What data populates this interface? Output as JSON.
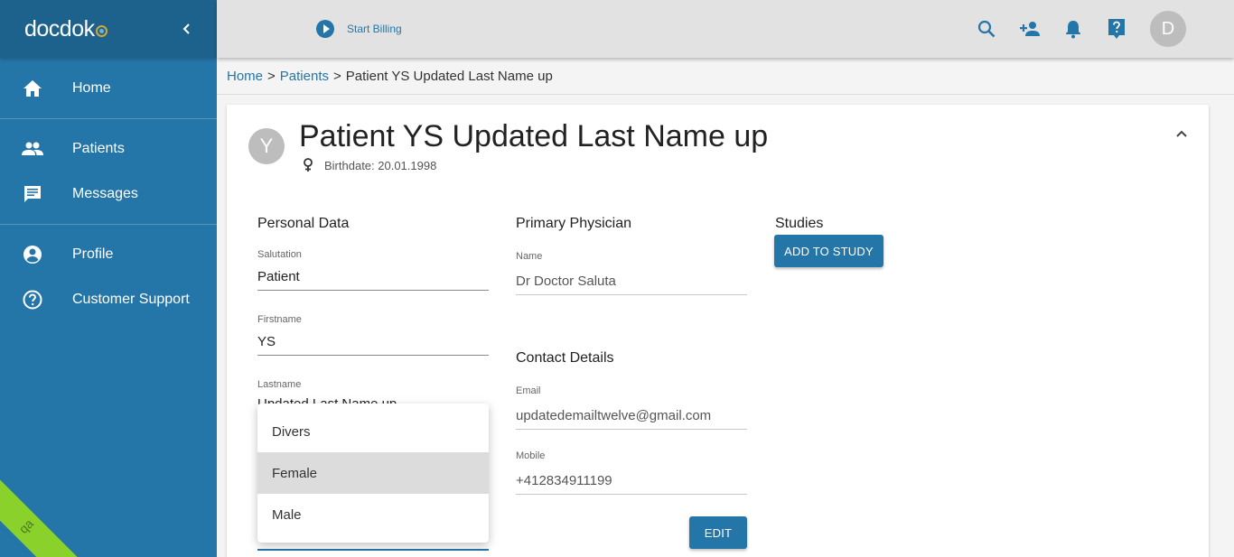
{
  "app": {
    "logo": "docdok",
    "qa_badge": "qa"
  },
  "sidebar": {
    "items": [
      {
        "label": "Home",
        "icon": "home-icon"
      },
      {
        "label": "Patients",
        "icon": "people-icon"
      },
      {
        "label": "Messages",
        "icon": "message-icon"
      },
      {
        "label": "Profile",
        "icon": "account-circle-icon"
      },
      {
        "label": "Customer Support",
        "icon": "help-circle-icon"
      }
    ]
  },
  "topbar": {
    "start_billing": "Start Billing",
    "user_initial": "D",
    "icons": [
      "search-icon",
      "add-person-icon",
      "bell-icon",
      "help-icon"
    ]
  },
  "breadcrumb": {
    "home": "Home",
    "patients": "Patients",
    "current": "Patient YS Updated Last Name up",
    "separator": ">"
  },
  "patient": {
    "initial": "Y",
    "name": "Patient YS Updated Last Name up",
    "birthdate": "Birthdate: 20.01.1998"
  },
  "personal_data": {
    "title": "Personal Data",
    "salutation_label": "Salutation",
    "salutation": "Patient",
    "firstname_label": "Firstname",
    "firstname": "YS",
    "lastname_label": "Lastname",
    "lastname_peek": "Updated Last Name up"
  },
  "primary_physician": {
    "title": "Primary Physician",
    "name_label": "Name",
    "name": "Dr Doctor Saluta"
  },
  "contact": {
    "title": "Contact Details",
    "email_label": "Email",
    "email": "updatedemailtwelve@gmail.com",
    "mobile_label": "Mobile",
    "mobile": "+412834911199"
  },
  "studies": {
    "title": "Studies",
    "add_button": "ADD TO STUDY"
  },
  "edit_button": "EDIT",
  "gender_menu": {
    "options": [
      "Divers",
      "Female",
      "Male"
    ],
    "selected": "Female"
  },
  "colors": {
    "primary": "#2576a8",
    "sidebar_header": "#1d628c",
    "qa_badge": "#8bd12c"
  }
}
